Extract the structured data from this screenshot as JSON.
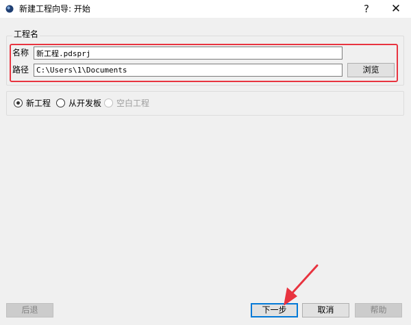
{
  "window": {
    "title": "新建工程向导: 开始",
    "help_label": "?",
    "close_label": "✕"
  },
  "group": {
    "title": "工程名",
    "name_label": "名称",
    "name_value": "新工程.pdsprj",
    "path_label": "路径",
    "path_value": "C:\\Users\\1\\Documents",
    "browse_label": "浏览"
  },
  "options": {
    "items": [
      {
        "label": "新工程",
        "selected": true,
        "enabled": true
      },
      {
        "label": "从开发板",
        "selected": false,
        "enabled": true
      },
      {
        "label": "空白工程",
        "selected": false,
        "enabled": false
      }
    ]
  },
  "footer": {
    "back_label": "后退",
    "next_label": "下一步",
    "cancel_label": "取消",
    "help_label": "帮助"
  },
  "colors": {
    "highlight": "#e8333f",
    "default_button_border": "#0078d7",
    "window_bg": "#f0f0f0"
  },
  "icons": {
    "app": "proteus-app-icon",
    "annotation": "red-arrow-annotation"
  }
}
